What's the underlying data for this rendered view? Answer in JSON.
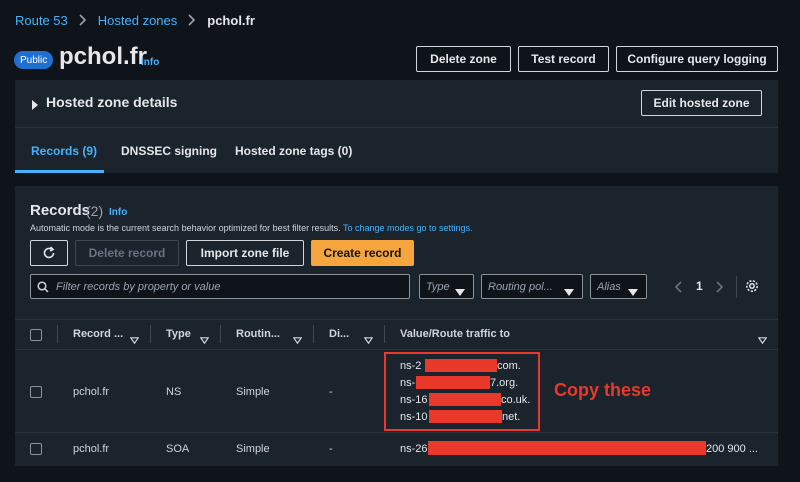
{
  "breadcrumb": {
    "items": [
      "Route 53",
      "Hosted zones"
    ],
    "current": "pchol.fr"
  },
  "header": {
    "badge": "Public",
    "title": "pchol.fr",
    "info": "Info",
    "buttons": {
      "delete": "Delete zone",
      "test": "Test record",
      "logging": "Configure query logging"
    }
  },
  "details": {
    "title": "Hosted zone details",
    "edit": "Edit hosted zone"
  },
  "tabs": [
    {
      "label": "Records (9)"
    },
    {
      "label": "DNSSEC signing"
    },
    {
      "label": "Hosted zone tags (0)"
    }
  ],
  "records": {
    "title": "Records",
    "count": "(2)",
    "info": "Info",
    "description": "Automatic mode is the current search behavior optimized for best filter results.",
    "description_link": "To change modes go to settings.",
    "buttons": {
      "delete": "Delete record",
      "import": "Import zone file",
      "create": "Create record"
    },
    "search_placeholder": "Filter records by property or value",
    "filters": {
      "type": "Type",
      "routing": "Routing pol...",
      "alias": "Alias"
    },
    "page": "1"
  },
  "table": {
    "columns": [
      "Record ...",
      "Type",
      "Routin...",
      "Di...",
      "Value/Route traffic to"
    ],
    "rows": [
      {
        "name": "pchol.fr",
        "type": "NS",
        "routing": "Simple",
        "di": "-",
        "values": [
          {
            "pre": "ns-2",
            "post": "com."
          },
          {
            "pre": "ns-",
            "post": "7.org."
          },
          {
            "pre": "ns-16",
            "post": "co.uk."
          },
          {
            "pre": "ns-10",
            "post": "net."
          }
        ]
      },
      {
        "name": "pchol.fr",
        "type": "SOA",
        "routing": "Simple",
        "di": "-",
        "value_pre": "ns-26",
        "value_post": "200 900 ..."
      }
    ]
  },
  "annotation": {
    "text": "Copy these",
    "color": "#e8392a"
  },
  "colors": {
    "accent": "#42b4ff",
    "primary_button": "#f5a53b",
    "badge": "#1f6fd1"
  }
}
